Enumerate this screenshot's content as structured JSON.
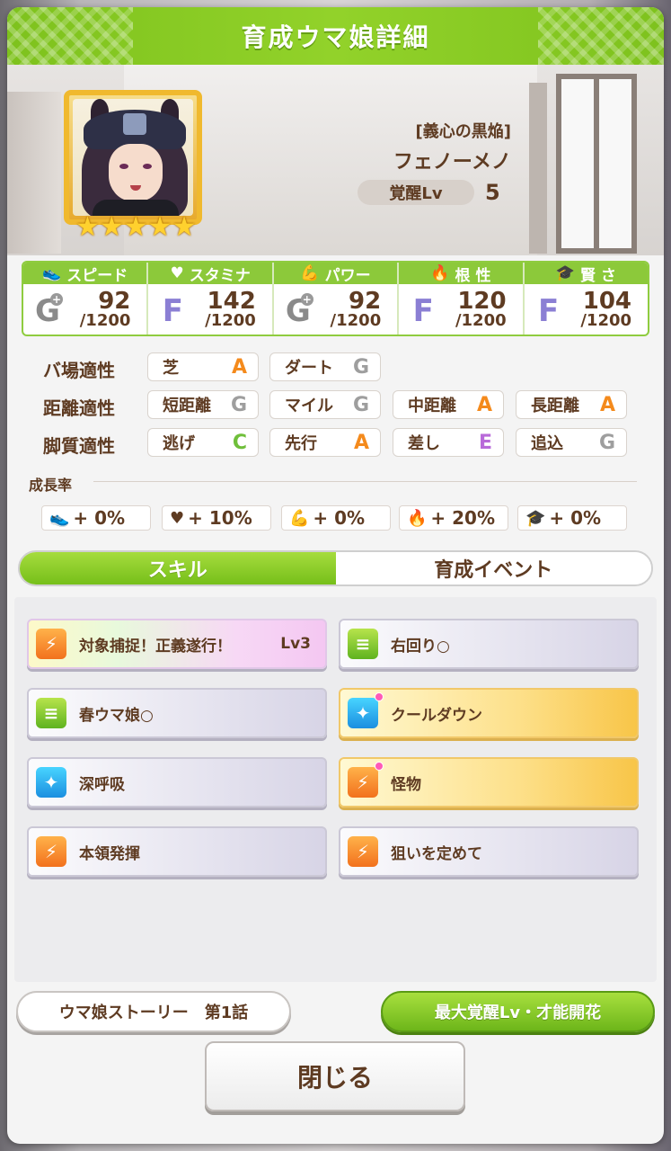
{
  "title": "育成ウマ娘詳細",
  "character": {
    "epithet": "[義心の黒焔]",
    "name": "フェノーメノ",
    "awaken_label": "覚醒Lv",
    "awaken_value": "5",
    "stars": "★★★★★"
  },
  "stats": [
    {
      "label": "スピード",
      "icon": "shoe-icon",
      "rank": "G",
      "plus": true,
      "value": "92",
      "max": "/1200"
    },
    {
      "label": "スタミナ",
      "icon": "heart-icon",
      "rank": "F",
      "plus": false,
      "value": "142",
      "max": "/1200"
    },
    {
      "label": "パワー",
      "icon": "muscle-icon",
      "rank": "G",
      "plus": true,
      "value": "92",
      "max": "/1200"
    },
    {
      "label": "根 性",
      "icon": "flame-icon",
      "rank": "F",
      "plus": false,
      "value": "120",
      "max": "/1200"
    },
    {
      "label": "賢 さ",
      "icon": "graduation-cap-icon",
      "rank": "F",
      "plus": false,
      "value": "104",
      "max": "/1200"
    }
  ],
  "aptitude": {
    "track": {
      "label": "バ場適性",
      "items": [
        {
          "name": "芝",
          "grade": "A"
        },
        {
          "name": "ダート",
          "grade": "G"
        }
      ]
    },
    "distance": {
      "label": "距離適性",
      "items": [
        {
          "name": "短距離",
          "grade": "G"
        },
        {
          "name": "マイル",
          "grade": "G"
        },
        {
          "name": "中距離",
          "grade": "A"
        },
        {
          "name": "長距離",
          "grade": "A"
        }
      ]
    },
    "style": {
      "label": "脚質適性",
      "items": [
        {
          "name": "逃げ",
          "grade": "C"
        },
        {
          "name": "先行",
          "grade": "A"
        },
        {
          "name": "差し",
          "grade": "E"
        },
        {
          "name": "追込",
          "grade": "G"
        }
      ]
    }
  },
  "growth": {
    "label": "成長率",
    "items": [
      {
        "icon": "shoe-icon",
        "value": "+ 0%"
      },
      {
        "icon": "heart-icon",
        "value": "+ 10%"
      },
      {
        "icon": "muscle-icon",
        "value": "+ 0%"
      },
      {
        "icon": "flame-icon",
        "value": "+ 20%"
      },
      {
        "icon": "graduation-cap-icon",
        "value": "+ 0%"
      }
    ]
  },
  "tabs": {
    "skills": "スキル",
    "events": "育成イベント"
  },
  "skills": [
    {
      "name": "対象捕捉！正義遂行！",
      "level": "Lv3",
      "style": "rainbow",
      "icon": "orange"
    },
    {
      "name": "右回り○",
      "level": "",
      "style": "normal",
      "icon": "green"
    },
    {
      "name": "春ウマ娘○",
      "level": "",
      "style": "normal",
      "icon": "green"
    },
    {
      "name": "クールダウン",
      "level": "",
      "style": "gold",
      "icon": "blue",
      "dot": true
    },
    {
      "name": "深呼吸",
      "level": "",
      "style": "normal",
      "icon": "blue"
    },
    {
      "name": "怪物",
      "level": "",
      "style": "gold",
      "icon": "orange",
      "dot": true
    },
    {
      "name": "本領発揮",
      "level": "",
      "style": "normal",
      "icon": "orange"
    },
    {
      "name": "狙いを定めて",
      "level": "",
      "style": "normal",
      "icon": "orange"
    }
  ],
  "buttons": {
    "story": "ウマ娘ストーリー　第1話",
    "max_awaken": "最大覚醒Lv・才能開花",
    "close": "閉じる"
  },
  "colors": {
    "accent_green": "#8cc93a",
    "brown_text": "#5e3b22",
    "grade_a": "#f48a1c",
    "gold_frame": "#f0b92e"
  }
}
